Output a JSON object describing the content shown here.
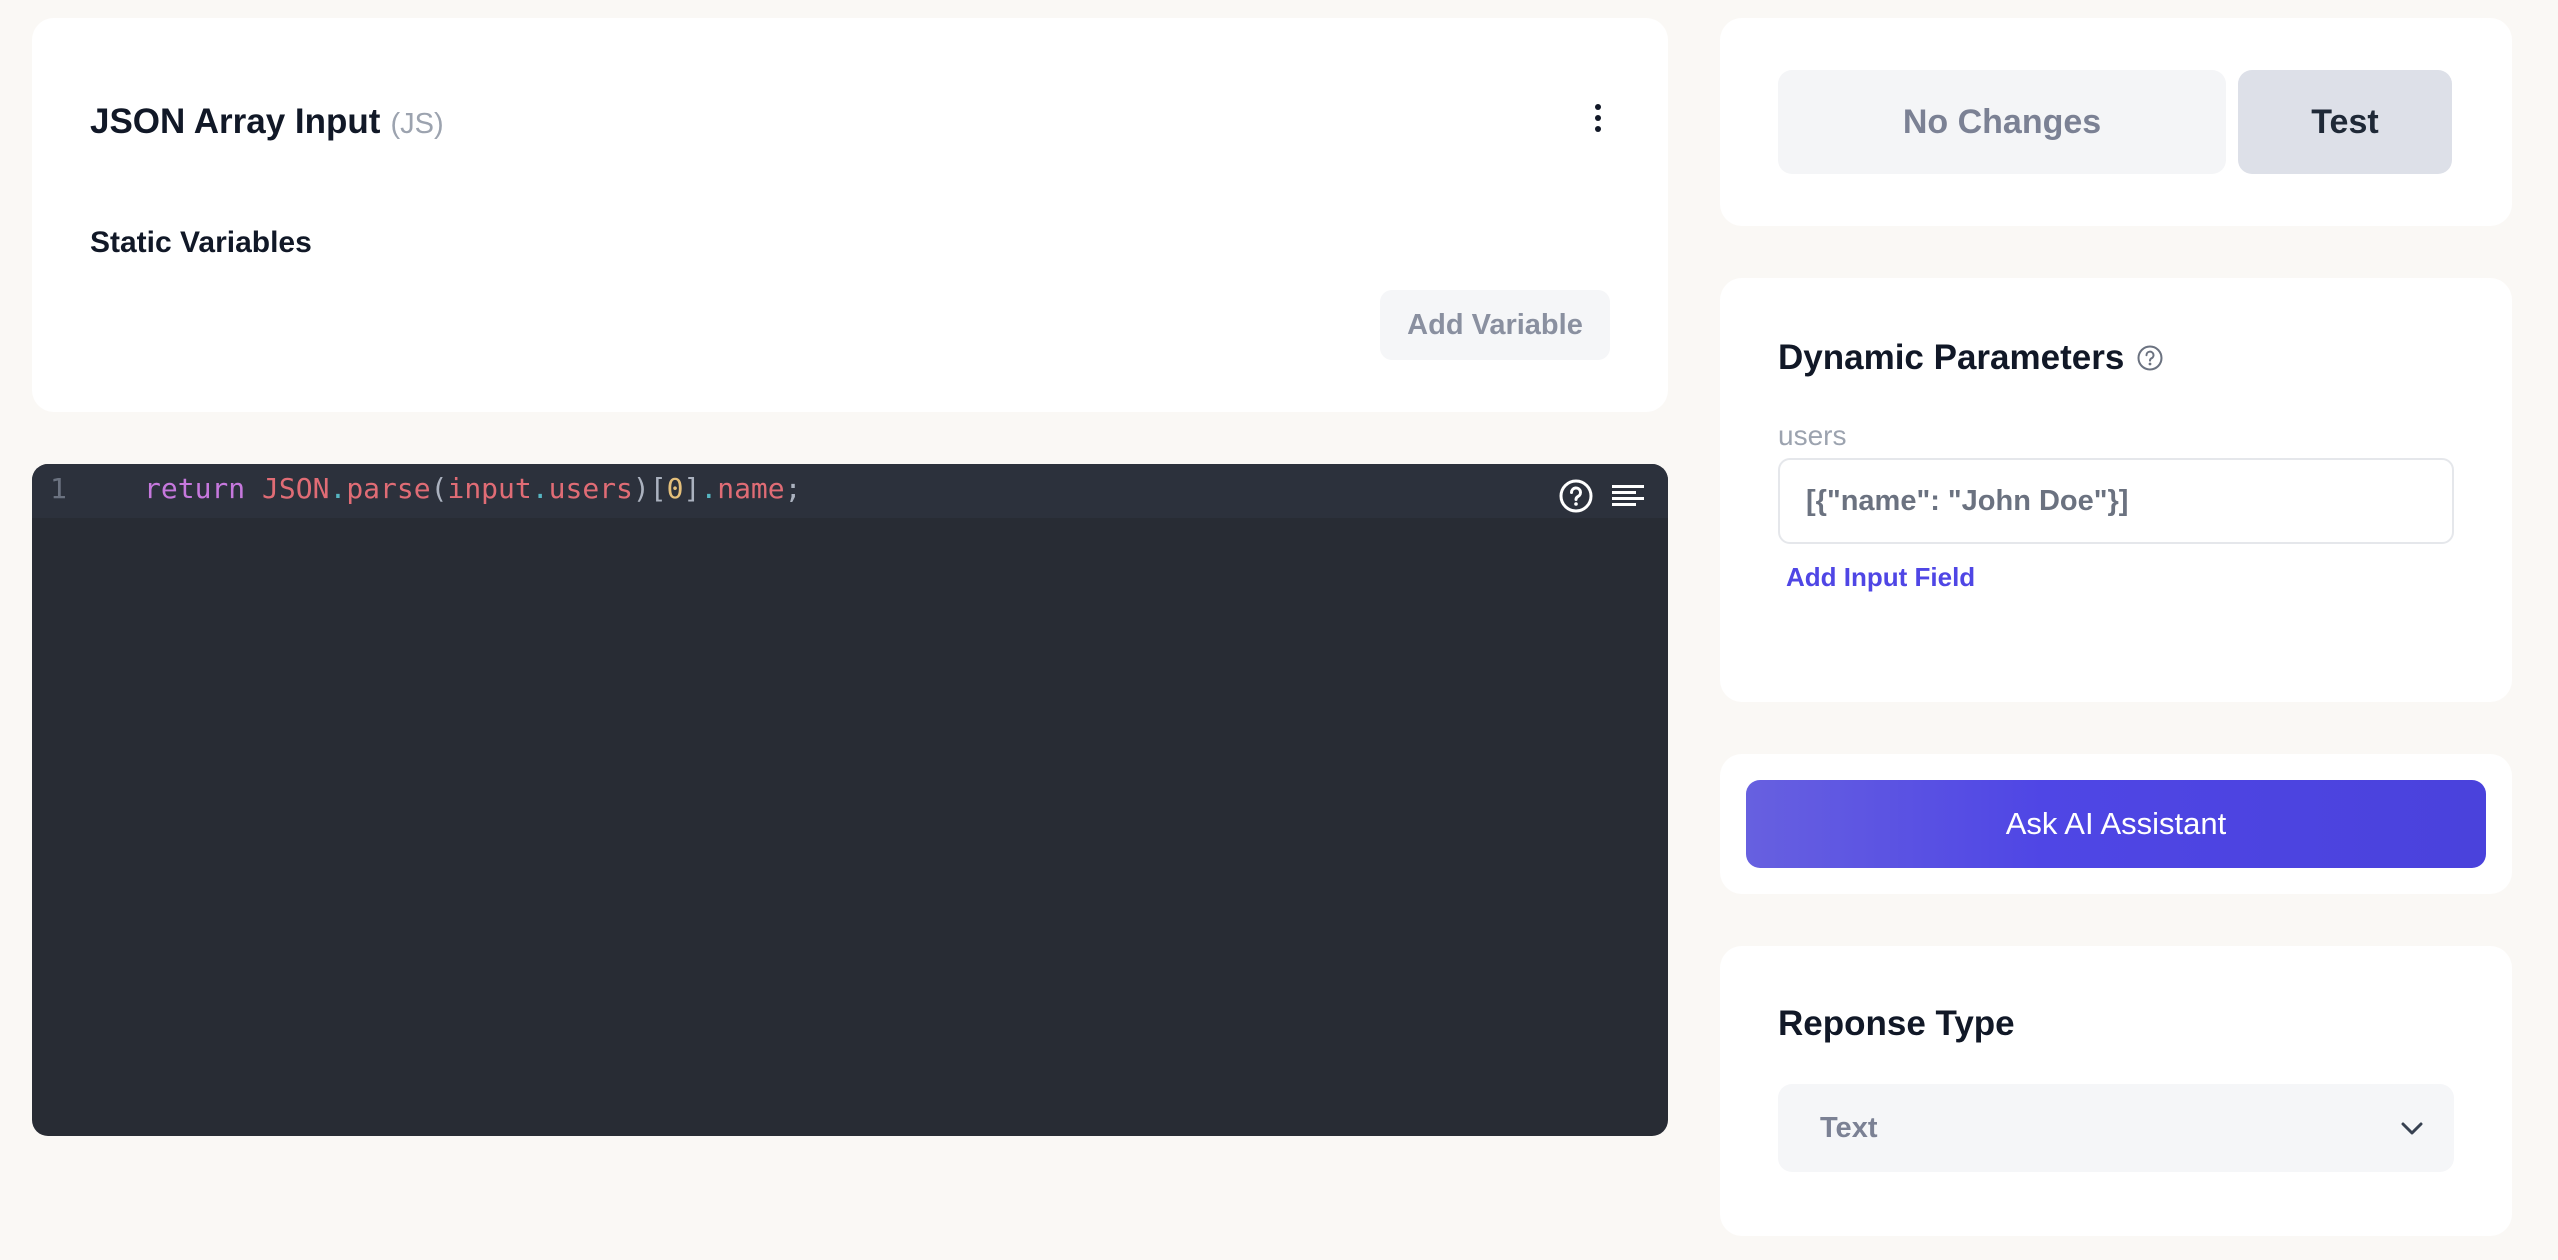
{
  "header": {
    "title": "JSON Array Input",
    "title_suffix": "(JS)",
    "static_variables_label": "Static Variables",
    "add_variable_label": "Add Variable"
  },
  "editor": {
    "line_number": "1",
    "code_tokens": {
      "t1": "return",
      "t2": " ",
      "t3": "JSON",
      "t4": ".",
      "t5": "parse",
      "t6": "(",
      "t7": "input",
      "t8": ".",
      "t9": "users",
      "t10": ")[",
      "t11": "0",
      "t12": "]",
      "t13": ".",
      "t14": "name",
      "t15": ";"
    },
    "icons": [
      "help-circle-icon",
      "format-lines-icon"
    ]
  },
  "actions": {
    "no_changes_label": "No Changes",
    "test_label": "Test"
  },
  "params": {
    "title": "Dynamic Parameters",
    "field_label": "users",
    "field_value": "[{\"name\": \"John Doe\"}]",
    "add_input_label": "Add Input Field"
  },
  "ai": {
    "button_label": "Ask AI Assistant"
  },
  "response": {
    "title": "Reponse Type",
    "selected": "Text"
  },
  "colors": {
    "accent": "#4f46e5",
    "editor_bg": "#282c34",
    "page_bg": "#faf8f5"
  }
}
